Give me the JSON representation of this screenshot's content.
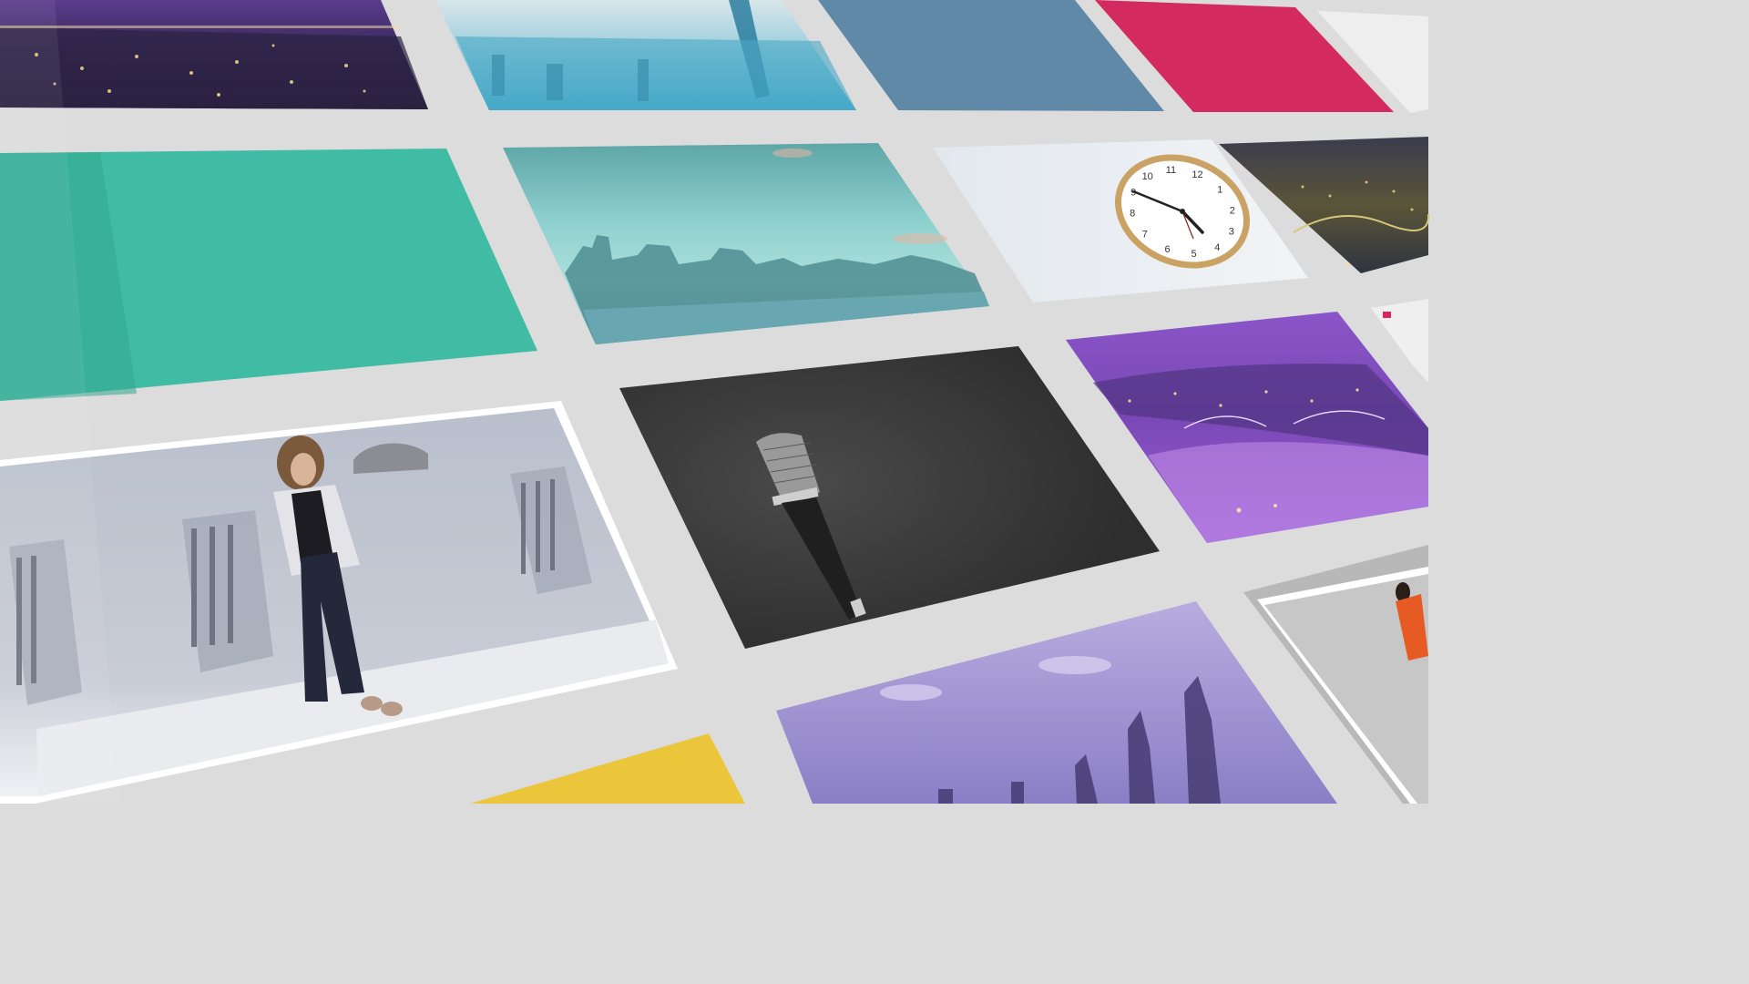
{
  "scene": {
    "background": "#dcdcdc",
    "panels": [
      {
        "name": "city-night-lights-tile",
        "kind": "city-night-purple"
      },
      {
        "name": "skyscraper-skyline-tile",
        "kind": "cyan-skyline"
      },
      {
        "name": "steel-blue-color-tile",
        "kind": "solid",
        "color": "#6089a8"
      },
      {
        "name": "crimson-color-tile",
        "kind": "solid",
        "color": "#d42a62"
      },
      {
        "name": "white-tile",
        "kind": "solid",
        "color": "#eeeeee"
      },
      {
        "name": "teal-color-tile",
        "kind": "solid",
        "color": "#3fbca3"
      },
      {
        "name": "city-skyline-dusk-tile",
        "kind": "teal-skyline"
      },
      {
        "name": "wall-clock-tile",
        "kind": "clock"
      },
      {
        "name": "bay-bridge-night-tile",
        "kind": "bridge-night"
      },
      {
        "name": "fashion-model-walking-tile",
        "kind": "fashion"
      },
      {
        "name": "microphone-tile",
        "kind": "microphone"
      },
      {
        "name": "purple-city-fog-tile",
        "kind": "purple-fog"
      },
      {
        "name": "model-orange-outfit-tile",
        "kind": "model-orange"
      },
      {
        "name": "yellow-color-tile",
        "kind": "solid",
        "color": "#ecc63a"
      },
      {
        "name": "lavender-city-towers-tile",
        "kind": "lavender-towers"
      }
    ],
    "clock": {
      "numerals": [
        "12",
        "1",
        "2",
        "3",
        "4",
        "5",
        "6",
        "7",
        "8",
        "9",
        "10",
        "11"
      ]
    }
  }
}
